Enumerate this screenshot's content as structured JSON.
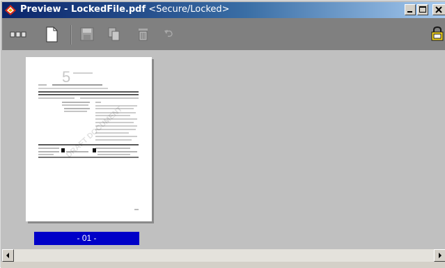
{
  "window": {
    "title_bold": "Preview - LockedFile.pdf",
    "title_rest": "<Secure/Locked>",
    "icon": "app-logo-icon"
  },
  "toolbar": {
    "items": [
      {
        "name": "thumbnails-view-button",
        "icon": "thumbnails-icon"
      },
      {
        "name": "single-page-button",
        "icon": "page-icon"
      },
      {
        "name": "save-button",
        "icon": "floppy-disk-icon"
      },
      {
        "name": "copy-button",
        "icon": "copy-icon"
      },
      {
        "name": "delete-button",
        "icon": "trash-icon"
      },
      {
        "name": "undo-button",
        "icon": "undo-icon"
      },
      {
        "name": "lock-status-button",
        "icon": "lock-icon"
      }
    ]
  },
  "preview": {
    "page_number_glyph": "5",
    "watermark": "DRAFT DOCUMENT",
    "page_label": "- 01 -"
  },
  "colors": {
    "accent_selection": "#0000c8",
    "titlebar_start": "#0a246a"
  }
}
